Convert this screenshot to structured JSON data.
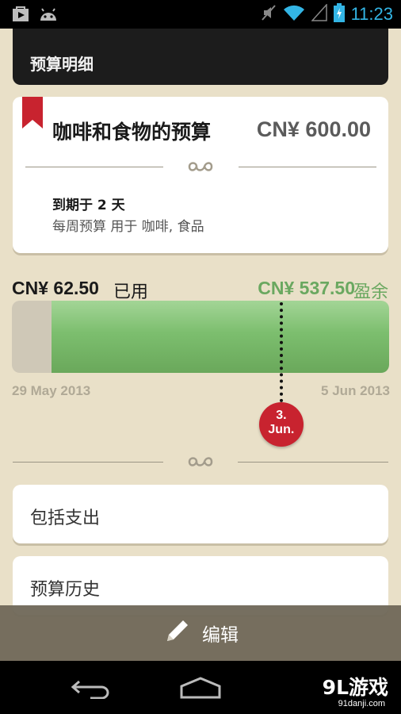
{
  "status_bar": {
    "time": "11:23"
  },
  "header": {
    "title": "预算明细"
  },
  "budget": {
    "name": "咖啡和食物的预算",
    "amount": "CN¥ 600.00",
    "due": "到期于 2 天",
    "description": "每周预算 用于 咖啡, 食品"
  },
  "progress": {
    "spent_amount": "CN¥ 62.50",
    "spent_label": "已用",
    "remaining_amount": "CN¥ 537.50",
    "remaining_label": "盈余",
    "remaining_fraction": 0.896,
    "start_date": "29 May 2013",
    "end_date": "5 Jun 2013",
    "today_day": "3.",
    "today_month": "Jun.",
    "today_fraction": 0.714
  },
  "rows": [
    {
      "label": "包括支出"
    },
    {
      "label": "预算历史"
    }
  ],
  "action_bar": {
    "edit_label": "编辑"
  },
  "watermark": {
    "text": "9L游戏",
    "url": "91danji.com"
  },
  "colors": {
    "accent_green": "#6aa860",
    "badge_red": "#c8232f",
    "background": "#e9e0c8"
  },
  "icons": [
    "play-store-icon",
    "android-icon",
    "muted-icon",
    "wifi-icon",
    "signal-icon",
    "battery-charging-icon",
    "bookmark-ribbon-icon",
    "ornament-icon",
    "pencil-icon",
    "back-icon",
    "home-icon"
  ]
}
